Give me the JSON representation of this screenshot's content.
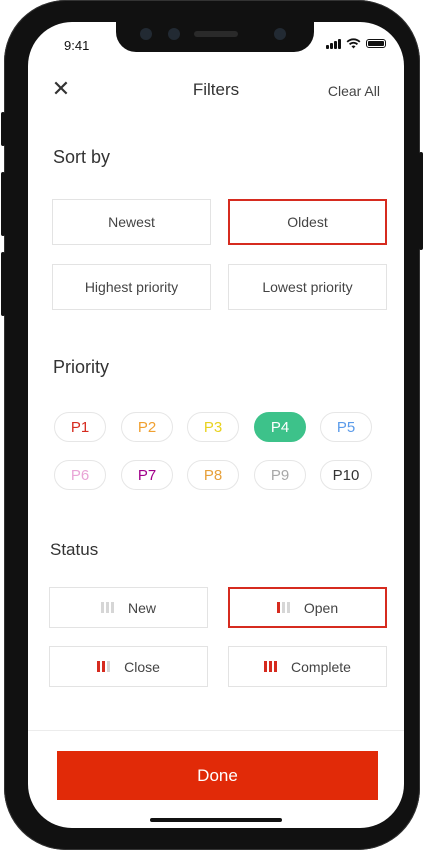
{
  "status_bar": {
    "time": "9:41"
  },
  "header": {
    "title": "Filters",
    "clear_label": "Clear All",
    "close_icon": "close-icon"
  },
  "sort": {
    "title": "Sort by",
    "options": [
      "Newest",
      "Oldest",
      "Highest priority",
      "Lowest priority"
    ],
    "selected": "Oldest"
  },
  "priority": {
    "title": "Priority",
    "items": [
      {
        "label": "P1",
        "color": "#d62b1f"
      },
      {
        "label": "P2",
        "color": "#f0a030"
      },
      {
        "label": "P3",
        "color": "#e8d21e"
      },
      {
        "label": "P4",
        "color": "#3dc28a"
      },
      {
        "label": "P5",
        "color": "#5b9bea"
      },
      {
        "label": "P6",
        "color": "#e9a4d6"
      },
      {
        "label": "P7",
        "color": "#a0008a"
      },
      {
        "label": "P8",
        "color": "#e7a03a"
      },
      {
        "label": "P9",
        "color": "#a8a8a8"
      },
      {
        "label": "P10",
        "color": "#333333"
      }
    ],
    "selected": "P4"
  },
  "status": {
    "title": "Status",
    "options": [
      {
        "label": "New",
        "level": 0
      },
      {
        "label": "Open",
        "level": 1
      },
      {
        "label": "Close",
        "level": 2
      },
      {
        "label": "Complete",
        "level": 3
      }
    ],
    "selected": "Open"
  },
  "footer": {
    "done_label": "Done"
  },
  "colors": {
    "accent": "#e12a08",
    "selected_border": "#d62b1f",
    "priority_selected": "#3dc28a"
  }
}
